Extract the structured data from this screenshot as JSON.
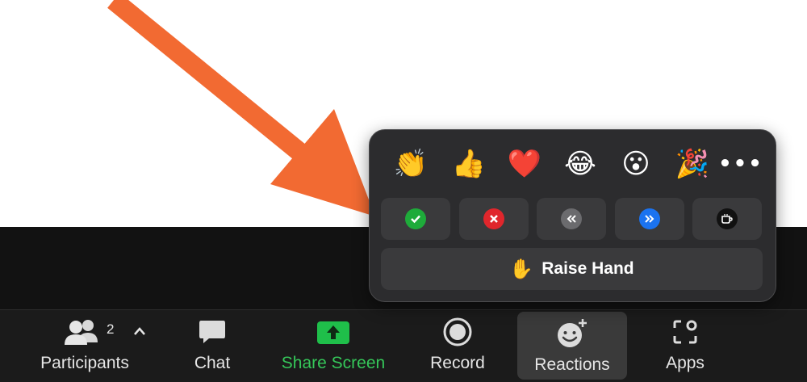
{
  "toolbar": {
    "participants": {
      "label": "Participants",
      "count": "2",
      "icon": "participants-icon"
    },
    "chat": {
      "label": "Chat",
      "icon": "chat-bubble-icon"
    },
    "share_screen": {
      "label": "Share Screen",
      "icon": "share-screen-icon",
      "color": "#35c759"
    },
    "record": {
      "label": "Record",
      "icon": "record-icon"
    },
    "reactions": {
      "label": "Reactions",
      "icon": "reactions-smiley-icon",
      "active": true
    },
    "apps": {
      "label": "Apps",
      "icon": "apps-icon"
    }
  },
  "reactions_popup": {
    "emojis": [
      {
        "name": "clapping-hands",
        "glyph": "👏"
      },
      {
        "name": "thumbs-up",
        "glyph": "👍"
      },
      {
        "name": "red-heart",
        "glyph": "❤️"
      },
      {
        "name": "tears-of-joy",
        "glyph": "😂"
      },
      {
        "name": "open-mouth",
        "glyph": "😮"
      },
      {
        "name": "party-popper",
        "glyph": "🎉"
      }
    ],
    "more_label": "•••",
    "feedback": [
      {
        "name": "yes",
        "icon": "checkmark-icon",
        "color": "#1eab3a"
      },
      {
        "name": "no",
        "icon": "x-icon",
        "color": "#e0262c"
      },
      {
        "name": "slow-down",
        "icon": "rewind-icon",
        "color": "#6b6b6e"
      },
      {
        "name": "speed-up",
        "icon": "fast-forward-icon",
        "color": "#1b73f0"
      },
      {
        "name": "coffee",
        "icon": "coffee-cup-icon",
        "color": "#111111"
      }
    ],
    "raise_hand": {
      "label": "Raise Hand",
      "glyph": "✋"
    }
  },
  "annotation_arrow_color": "#f26a32"
}
